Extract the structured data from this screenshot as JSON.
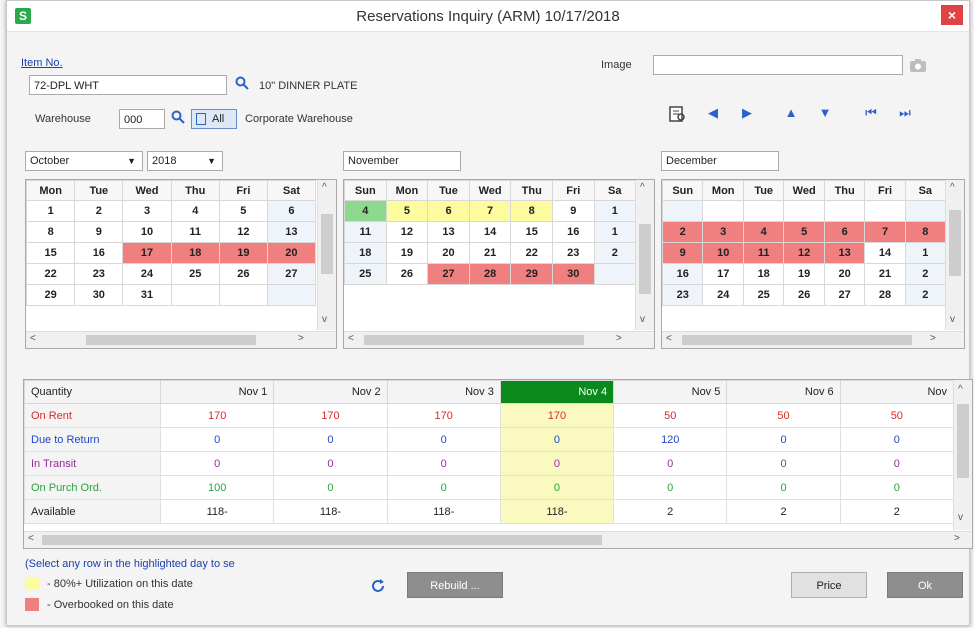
{
  "window": {
    "title": "Reservations Inquiry (ARM) 10/17/2018",
    "close_glyph": "×",
    "app_icon": "S"
  },
  "item": {
    "label": "Item No.",
    "value": "72-DPL WHT",
    "description": "10\" DINNER PLATE",
    "warehouse_label": "Warehouse",
    "warehouse_value": "000",
    "all_label": "All",
    "warehouse_name": "Corporate Warehouse"
  },
  "image": {
    "label": "Image",
    "value": ""
  },
  "calendars": {
    "left": {
      "month": "October",
      "year": "2018",
      "headers": [
        "Mon",
        "Tue",
        "Wed",
        "Thu",
        "Fri",
        "Sat"
      ],
      "rows": [
        [
          "1",
          "2",
          "3",
          "4",
          "5",
          "6"
        ],
        [
          "8",
          "9",
          "10",
          "11",
          "12",
          "13"
        ],
        [
          "15",
          "16",
          "17",
          "18",
          "19",
          "20"
        ],
        [
          "22",
          "23",
          "24",
          "25",
          "26",
          "27"
        ],
        [
          "29",
          "30",
          "31",
          "",
          "",
          ""
        ]
      ],
      "overbooked": [
        "17",
        "18",
        "19",
        "20"
      ],
      "utilized": [],
      "selected": []
    },
    "middle": {
      "month": "November",
      "headers": [
        "Sun",
        "Mon",
        "Tue",
        "Wed",
        "Thu",
        "Fri",
        "Sa"
      ],
      "rows": [
        [
          "4",
          "5",
          "6",
          "7",
          "8",
          "9",
          "1"
        ],
        [
          "11",
          "12",
          "13",
          "14",
          "15",
          "16",
          "1"
        ],
        [
          "18",
          "19",
          "20",
          "21",
          "22",
          "23",
          "2"
        ],
        [
          "25",
          "26",
          "27",
          "28",
          "29",
          "30",
          ""
        ]
      ],
      "overbooked": [
        "27",
        "28",
        "29",
        "30"
      ],
      "utilized": [
        "5",
        "6",
        "7",
        "8"
      ],
      "selected": [
        "4"
      ]
    },
    "right": {
      "month": "December",
      "headers": [
        "Sun",
        "Mon",
        "Tue",
        "Wed",
        "Thu",
        "Fri",
        "Sa"
      ],
      "rows": [
        [
          "",
          "",
          "",
          "",
          "",
          "",
          ""
        ],
        [
          "2",
          "3",
          "4",
          "5",
          "6",
          "7",
          "8"
        ],
        [
          "9",
          "10",
          "11",
          "12",
          "13",
          "14",
          "1"
        ],
        [
          "16",
          "17",
          "18",
          "19",
          "20",
          "21",
          "2"
        ],
        [
          "23",
          "24",
          "25",
          "26",
          "27",
          "28",
          "2"
        ]
      ],
      "overbooked": [
        "2",
        "3",
        "4",
        "5",
        "6",
        "7",
        "8",
        "9",
        "10",
        "11",
        "12",
        "13"
      ],
      "utilized": [],
      "selected": []
    }
  },
  "grid": {
    "header_label": "Quantity",
    "columns": [
      "Nov 1",
      "Nov 2",
      "Nov 3",
      "Nov 4",
      "Nov 5",
      "Nov 6",
      "Nov"
    ],
    "selected_column": 3,
    "rows": [
      {
        "label": "On Rent",
        "color": "red",
        "values": [
          "170",
          "170",
          "170",
          "170",
          "50",
          "50",
          "50"
        ]
      },
      {
        "label": "Due to Return",
        "color": "blue",
        "values": [
          "0",
          "0",
          "0",
          "0",
          "120",
          "0",
          "0"
        ]
      },
      {
        "label": "In Transit",
        "color": "purple",
        "values": [
          "0",
          "0",
          "0",
          "0",
          "0",
          "0",
          "0"
        ]
      },
      {
        "label": "On Purch Ord.",
        "color": "green",
        "values": [
          "100",
          "0",
          "0",
          "0",
          "0",
          "0",
          "0"
        ]
      },
      {
        "label": "Available",
        "color": "black",
        "values": [
          "118-",
          "118-",
          "118-",
          "118-",
          "2",
          "2",
          "2"
        ]
      }
    ]
  },
  "footer": {
    "hint": "(Select any row in the highlighted day to se",
    "legend_yellow": "- 80%+ Utilization on this date",
    "legend_red": "- Overbooked on this date",
    "rebuild_label": "Rebuild ...",
    "price_label": "Price",
    "ok_label": "Ok"
  },
  "colors": {
    "overbooked": "#f08080",
    "utilized": "#fcfc9e",
    "selected_day": "#8fd88f",
    "selected_column": "#0a8a1a"
  }
}
